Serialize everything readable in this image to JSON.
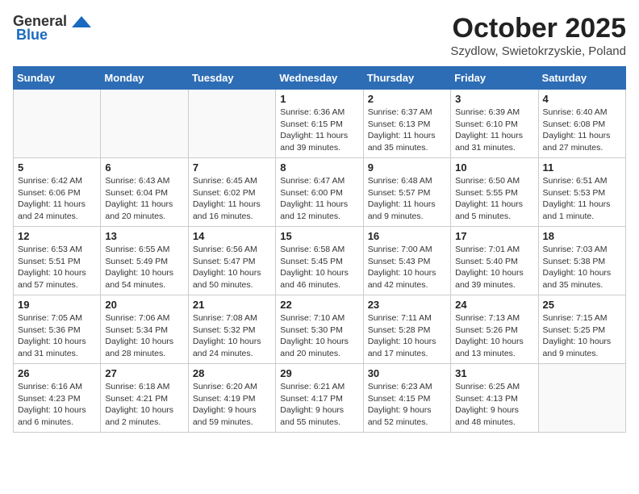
{
  "logo": {
    "general": "General",
    "blue": "Blue"
  },
  "title": "October 2025",
  "location": "Szydlow, Swietokrzyskie, Poland",
  "days_of_week": [
    "Sunday",
    "Monday",
    "Tuesday",
    "Wednesday",
    "Thursday",
    "Friday",
    "Saturday"
  ],
  "weeks": [
    [
      {
        "day": "",
        "info": ""
      },
      {
        "day": "",
        "info": ""
      },
      {
        "day": "",
        "info": ""
      },
      {
        "day": "1",
        "info": "Sunrise: 6:36 AM\nSunset: 6:15 PM\nDaylight: 11 hours\nand 39 minutes."
      },
      {
        "day": "2",
        "info": "Sunrise: 6:37 AM\nSunset: 6:13 PM\nDaylight: 11 hours\nand 35 minutes."
      },
      {
        "day": "3",
        "info": "Sunrise: 6:39 AM\nSunset: 6:10 PM\nDaylight: 11 hours\nand 31 minutes."
      },
      {
        "day": "4",
        "info": "Sunrise: 6:40 AM\nSunset: 6:08 PM\nDaylight: 11 hours\nand 27 minutes."
      }
    ],
    [
      {
        "day": "5",
        "info": "Sunrise: 6:42 AM\nSunset: 6:06 PM\nDaylight: 11 hours\nand 24 minutes."
      },
      {
        "day": "6",
        "info": "Sunrise: 6:43 AM\nSunset: 6:04 PM\nDaylight: 11 hours\nand 20 minutes."
      },
      {
        "day": "7",
        "info": "Sunrise: 6:45 AM\nSunset: 6:02 PM\nDaylight: 11 hours\nand 16 minutes."
      },
      {
        "day": "8",
        "info": "Sunrise: 6:47 AM\nSunset: 6:00 PM\nDaylight: 11 hours\nand 12 minutes."
      },
      {
        "day": "9",
        "info": "Sunrise: 6:48 AM\nSunset: 5:57 PM\nDaylight: 11 hours\nand 9 minutes."
      },
      {
        "day": "10",
        "info": "Sunrise: 6:50 AM\nSunset: 5:55 PM\nDaylight: 11 hours\nand 5 minutes."
      },
      {
        "day": "11",
        "info": "Sunrise: 6:51 AM\nSunset: 5:53 PM\nDaylight: 11 hours\nand 1 minute."
      }
    ],
    [
      {
        "day": "12",
        "info": "Sunrise: 6:53 AM\nSunset: 5:51 PM\nDaylight: 10 hours\nand 57 minutes."
      },
      {
        "day": "13",
        "info": "Sunrise: 6:55 AM\nSunset: 5:49 PM\nDaylight: 10 hours\nand 54 minutes."
      },
      {
        "day": "14",
        "info": "Sunrise: 6:56 AM\nSunset: 5:47 PM\nDaylight: 10 hours\nand 50 minutes."
      },
      {
        "day": "15",
        "info": "Sunrise: 6:58 AM\nSunset: 5:45 PM\nDaylight: 10 hours\nand 46 minutes."
      },
      {
        "day": "16",
        "info": "Sunrise: 7:00 AM\nSunset: 5:43 PM\nDaylight: 10 hours\nand 42 minutes."
      },
      {
        "day": "17",
        "info": "Sunrise: 7:01 AM\nSunset: 5:40 PM\nDaylight: 10 hours\nand 39 minutes."
      },
      {
        "day": "18",
        "info": "Sunrise: 7:03 AM\nSunset: 5:38 PM\nDaylight: 10 hours\nand 35 minutes."
      }
    ],
    [
      {
        "day": "19",
        "info": "Sunrise: 7:05 AM\nSunset: 5:36 PM\nDaylight: 10 hours\nand 31 minutes."
      },
      {
        "day": "20",
        "info": "Sunrise: 7:06 AM\nSunset: 5:34 PM\nDaylight: 10 hours\nand 28 minutes."
      },
      {
        "day": "21",
        "info": "Sunrise: 7:08 AM\nSunset: 5:32 PM\nDaylight: 10 hours\nand 24 minutes."
      },
      {
        "day": "22",
        "info": "Sunrise: 7:10 AM\nSunset: 5:30 PM\nDaylight: 10 hours\nand 20 minutes."
      },
      {
        "day": "23",
        "info": "Sunrise: 7:11 AM\nSunset: 5:28 PM\nDaylight: 10 hours\nand 17 minutes."
      },
      {
        "day": "24",
        "info": "Sunrise: 7:13 AM\nSunset: 5:26 PM\nDaylight: 10 hours\nand 13 minutes."
      },
      {
        "day": "25",
        "info": "Sunrise: 7:15 AM\nSunset: 5:25 PM\nDaylight: 10 hours\nand 9 minutes."
      }
    ],
    [
      {
        "day": "26",
        "info": "Sunrise: 6:16 AM\nSunset: 4:23 PM\nDaylight: 10 hours\nand 6 minutes."
      },
      {
        "day": "27",
        "info": "Sunrise: 6:18 AM\nSunset: 4:21 PM\nDaylight: 10 hours\nand 2 minutes."
      },
      {
        "day": "28",
        "info": "Sunrise: 6:20 AM\nSunset: 4:19 PM\nDaylight: 9 hours\nand 59 minutes."
      },
      {
        "day": "29",
        "info": "Sunrise: 6:21 AM\nSunset: 4:17 PM\nDaylight: 9 hours\nand 55 minutes."
      },
      {
        "day": "30",
        "info": "Sunrise: 6:23 AM\nSunset: 4:15 PM\nDaylight: 9 hours\nand 52 minutes."
      },
      {
        "day": "31",
        "info": "Sunrise: 6:25 AM\nSunset: 4:13 PM\nDaylight: 9 hours\nand 48 minutes."
      },
      {
        "day": "",
        "info": ""
      }
    ]
  ]
}
